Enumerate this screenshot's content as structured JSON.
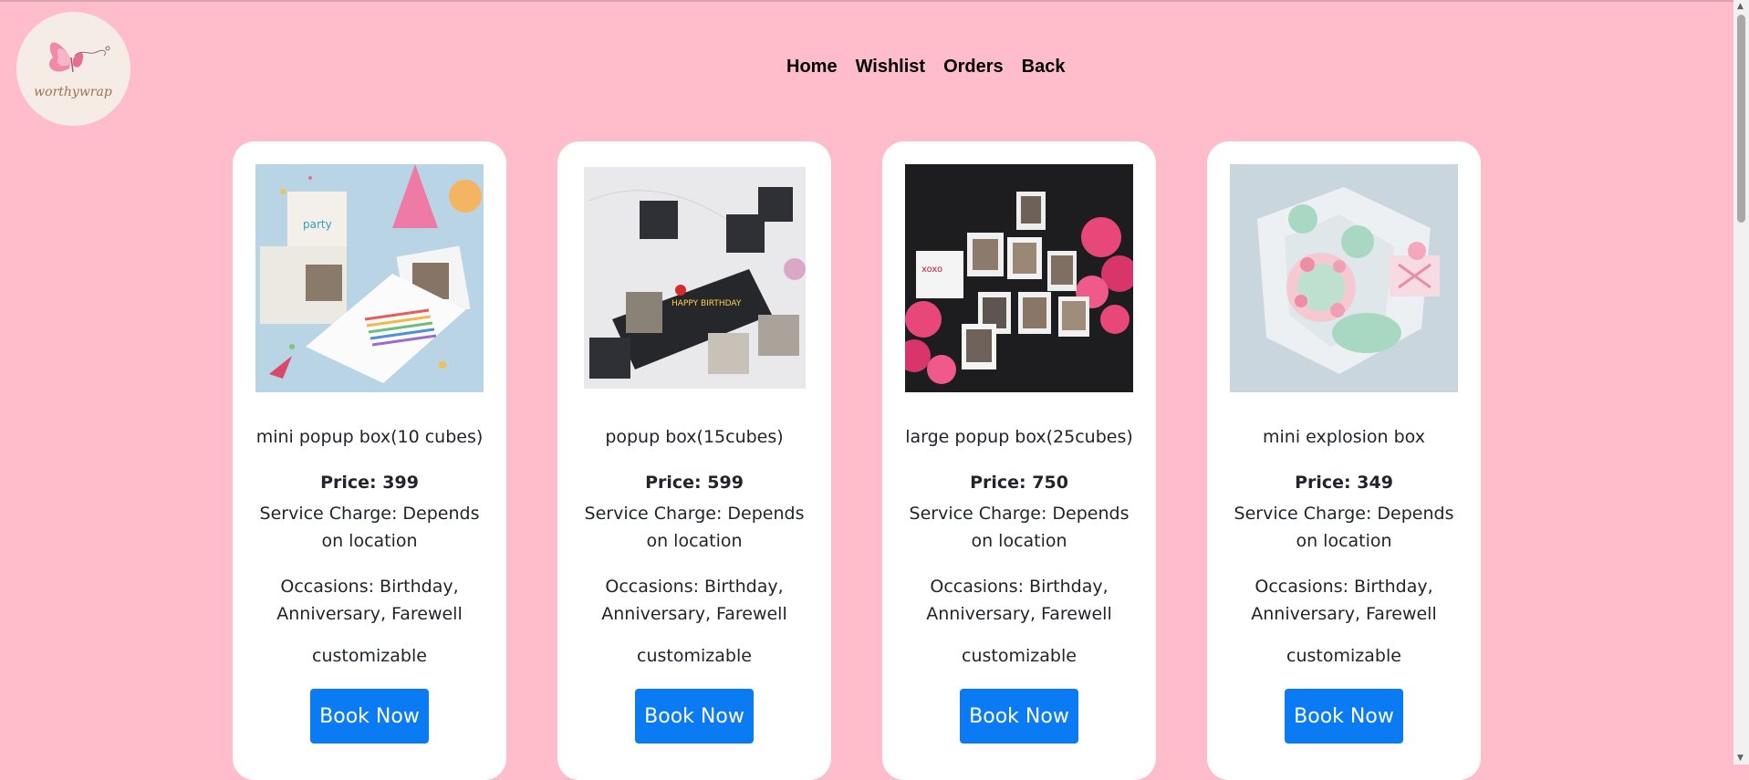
{
  "brand": {
    "logo_text": "worthywrap",
    "logo_icon": "butterfly-icon"
  },
  "nav": {
    "home": "Home",
    "wishlist": "Wishlist",
    "orders": "Orders",
    "back": "Back"
  },
  "products": [
    {
      "name": "mini popup box(10 cubes)",
      "price": "Price: 399",
      "service": "Service Charge: Depends on location",
      "occasions": "Occasions: Birthday, Anniversary, Farewell",
      "customizable": "customizable",
      "button": "Book Now"
    },
    {
      "name": "popup box(15cubes)",
      "price": "Price: 599",
      "service": "Service Charge: Depends on location",
      "occasions": "Occasions: Birthday, Anniversary, Farewell",
      "customizable": "customizable",
      "button": "Book Now"
    },
    {
      "name": "large popup box(25cubes)",
      "price": "Price: 750",
      "service": "Service Charge: Depends on location",
      "occasions": "Occasions: Birthday, Anniversary, Farewell",
      "customizable": "customizable",
      "button": "Book Now"
    },
    {
      "name": "mini explosion box",
      "price": "Price: 349",
      "service": "Service Charge: Depends on location",
      "occasions": "Occasions: Birthday, Anniversary, Farewell",
      "customizable": "customizable",
      "button": "Book Now"
    }
  ],
  "colors": {
    "background": "#ffbdcb",
    "card": "#ffffff",
    "button": "#0b7bf3"
  }
}
